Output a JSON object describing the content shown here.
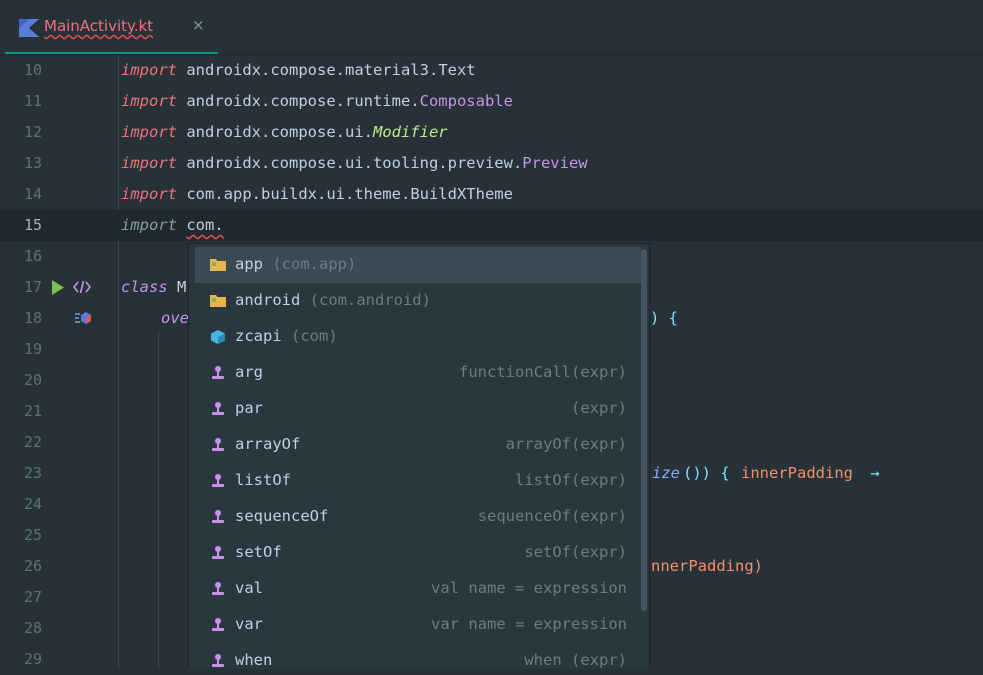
{
  "tab": {
    "title": "MainActivity.kt",
    "close": "×"
  },
  "lines": [
    {
      "n": "10",
      "kw": "import",
      "pkg": "androidx.compose.material3.",
      "cls": "Text",
      "style": "plain"
    },
    {
      "n": "11",
      "kw": "import",
      "pkg": "androidx.compose.runtime.",
      "cls": "Composable",
      "style": "class"
    },
    {
      "n": "12",
      "kw": "import",
      "pkg": "androidx.compose.ui.",
      "cls": "Modifier",
      "style": "italic"
    },
    {
      "n": "13",
      "kw": "import",
      "pkg": "androidx.compose.ui.tooling.preview.",
      "cls": "Preview",
      "style": "class"
    },
    {
      "n": "14",
      "kw": "import",
      "pkg": "com.app.buildx.ui.theme.",
      "cls": "BuildXTheme",
      "style": "plain"
    },
    {
      "n": "15",
      "kw": "import",
      "pkg": "com.",
      "cls": "",
      "style": "current"
    },
    {
      "n": "16"
    },
    {
      "n": "17",
      "kw": "class",
      "pkg": "M"
    },
    {
      "n": "18",
      "kw": "ove"
    },
    {
      "n": "19"
    },
    {
      "n": "20"
    },
    {
      "n": "21"
    },
    {
      "n": "22"
    },
    {
      "n": "23"
    },
    {
      "n": "24"
    },
    {
      "n": "25"
    },
    {
      "n": "26"
    },
    {
      "n": "27"
    },
    {
      "n": "28"
    },
    {
      "n": "29"
    }
  ],
  "fragments": {
    "l18": ") {",
    "l23a": "ize",
    "l23b": "()) { ",
    "l23c": "innerPadding",
    "l23d": " →",
    "l26": "nnerPadding)"
  },
  "completion": [
    {
      "name": "app",
      "hint": " (com.app)",
      "tail": "",
      "icon": "folder-icon",
      "selected": true
    },
    {
      "name": "android",
      "hint": " (com.android)",
      "tail": "",
      "icon": "folder-icon"
    },
    {
      "name": "zcapi",
      "hint": " (com)",
      "tail": "",
      "icon": "package-icon"
    },
    {
      "name": "arg",
      "hint": "",
      "tail": "functionCall(expr)",
      "icon": "template-icon"
    },
    {
      "name": "par",
      "hint": "",
      "tail": "(expr)",
      "icon": "template-icon"
    },
    {
      "name": "arrayOf",
      "hint": "",
      "tail": "arrayOf(expr)",
      "icon": "template-icon"
    },
    {
      "name": "listOf",
      "hint": "",
      "tail": "listOf(expr)",
      "icon": "template-icon"
    },
    {
      "name": "sequenceOf",
      "hint": "",
      "tail": "sequenceOf(expr)",
      "icon": "template-icon"
    },
    {
      "name": "setOf",
      "hint": "",
      "tail": "setOf(expr)",
      "icon": "template-icon"
    },
    {
      "name": "val",
      "hint": "",
      "tail": "val name = expression",
      "icon": "template-icon"
    },
    {
      "name": "var",
      "hint": "",
      "tail": "var name = expression",
      "icon": "template-icon"
    },
    {
      "name": "when",
      "hint": "",
      "tail": "when (expr)",
      "icon": "template-icon"
    }
  ],
  "colors": {
    "background": "#263238",
    "keyword": "#c792ea",
    "import": "#f07178",
    "popup": "#2b373e",
    "accent": "#009688"
  }
}
